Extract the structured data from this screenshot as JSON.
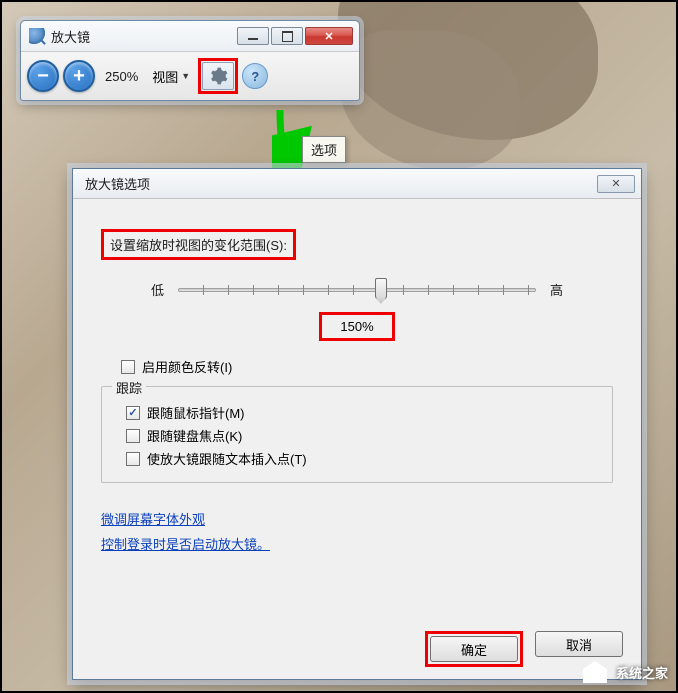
{
  "magnifier": {
    "title": "放大镜",
    "zoom_level": "250%",
    "view_label": "视图"
  },
  "tooltip": "选项",
  "dialog": {
    "title": "放大镜选项",
    "section_label": "设置缩放时视图的变化范围(S):",
    "slider": {
      "low": "低",
      "high": "高",
      "value": "150%"
    },
    "invert_colors": "启用颜色反转(I)",
    "tracking_group": "跟踪",
    "follow_mouse": "跟随鼠标指针(M)",
    "follow_keyboard": "跟随键盘焦点(K)",
    "follow_text": "使放大镜跟随文本插入点(T)",
    "link_font": "微调屏幕字体外观",
    "link_startup": "控制登录时是否启动放大镜。",
    "ok": "确定",
    "cancel": "取消"
  },
  "watermark": "系统之家"
}
